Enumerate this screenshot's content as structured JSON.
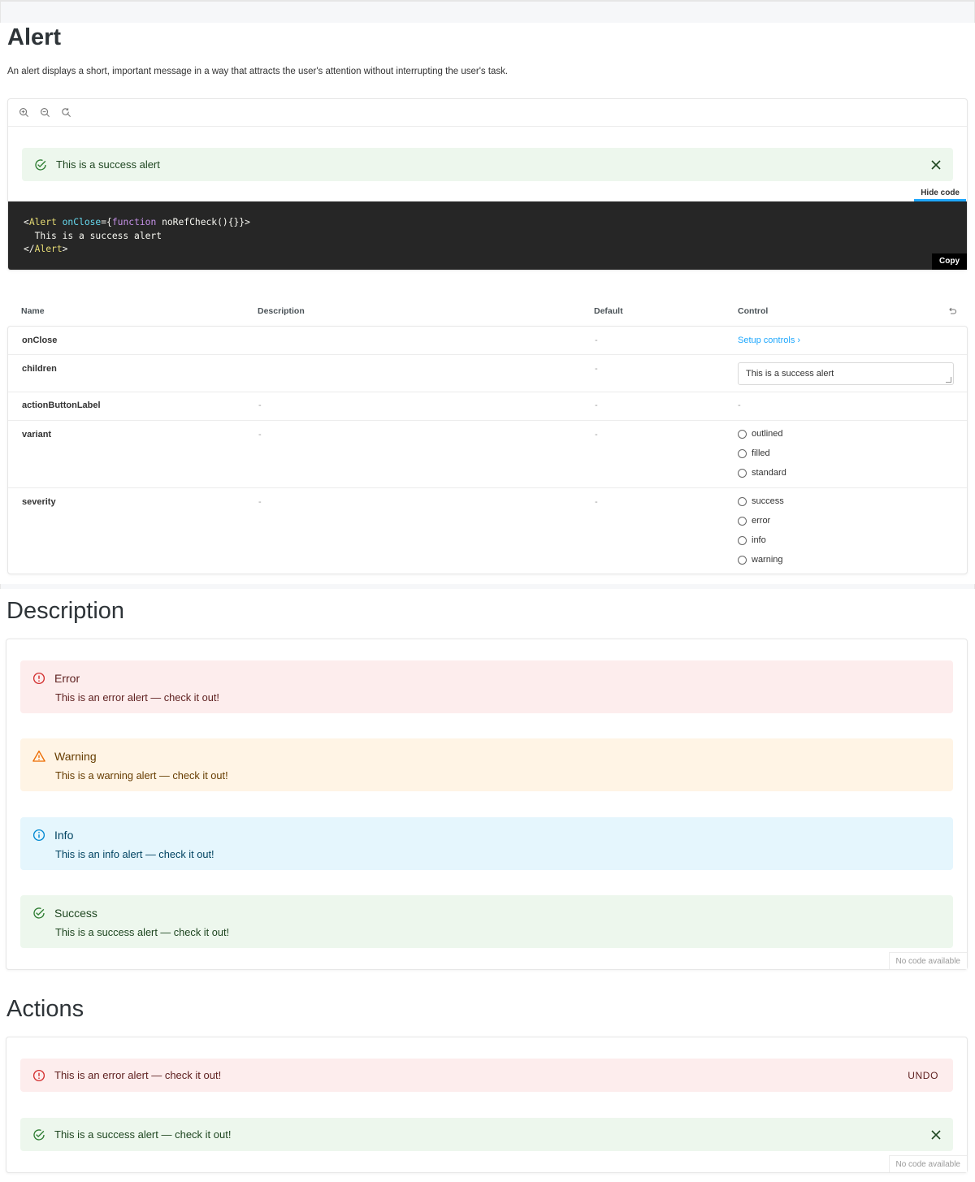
{
  "page": {
    "title": "Alert",
    "description": "An alert displays a short, important message in a way that attracts the user's attention without interrupting the user's task."
  },
  "preview": {
    "toolbar": [
      "zoom-in",
      "zoom-out",
      "reset-zoom"
    ],
    "alert_text": "This is a success alert",
    "hide_code_label": "Hide code",
    "copy_label": "Copy",
    "code": {
      "line1_open": "<",
      "line1_tag": "Alert",
      "line1_attr": " onClose",
      "line1_eq": "={",
      "line1_kw": "function",
      "line1_rest": " noRefCheck(){}}>",
      "line2": "  This is a success alert",
      "line3_open": "</",
      "line3_tag": "Alert",
      "line3_close": ">"
    }
  },
  "args_table": {
    "headers": {
      "name": "Name",
      "description": "Description",
      "default": "Default",
      "control": "Control"
    },
    "rows": [
      {
        "name": "onClose",
        "description": "",
        "default": "-",
        "control": "Setup controls ›"
      },
      {
        "name": "children",
        "description": "",
        "default": "-",
        "control_value": "This is a success alert"
      },
      {
        "name": "actionButtonLabel",
        "description": "-",
        "default": "-",
        "control": "-"
      },
      {
        "name": "variant",
        "description": "-",
        "default": "-",
        "options": [
          "outlined",
          "filled",
          "standard"
        ]
      },
      {
        "name": "severity",
        "description": "-",
        "default": "-",
        "options": [
          "success",
          "error",
          "info",
          "warning"
        ]
      }
    ]
  },
  "description_section": {
    "title": "Description",
    "alerts": [
      {
        "severity": "error",
        "title": "Error",
        "message": "This is an error alert — check it out!"
      },
      {
        "severity": "warning",
        "title": "Warning",
        "message": "This is a warning alert — check it out!"
      },
      {
        "severity": "info",
        "title": "Info",
        "message": "This is an info alert — check it out!"
      },
      {
        "severity": "success",
        "title": "Success",
        "message": "This is a success alert — check it out!"
      }
    ],
    "no_code": "No code available"
  },
  "actions_section": {
    "title": "Actions",
    "error_message": "This is an error alert — check it out!",
    "undo_label": "UNDO",
    "success_message": "This is a success alert — check it out!",
    "no_code": "No code available"
  },
  "colors": {
    "success_bg": "#edf7ed",
    "success_icon": "#2e7d32",
    "error_bg": "#fdeded",
    "error_icon": "#d32f2f",
    "warning_bg": "#fff4e5",
    "warning_icon": "#ed6c02",
    "info_bg": "#e5f6fd",
    "info_icon": "#0288d1",
    "accent": "#1ea7fd"
  }
}
